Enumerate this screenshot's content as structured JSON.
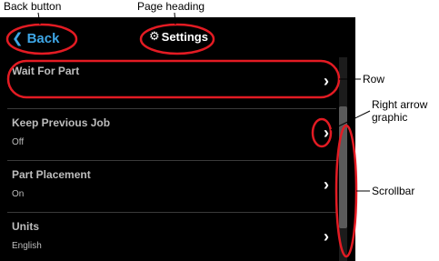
{
  "callouts": {
    "back": "Back button",
    "heading": "Page heading",
    "row": "Row",
    "arrow_line1": "Right arrow",
    "arrow_line2": "graphic",
    "scrollbar": "Scrollbar"
  },
  "header": {
    "back_label": "Back",
    "back_icon": "chevron-left-icon",
    "title": "Settings",
    "title_icon": "gear-icon"
  },
  "rows": [
    {
      "title": "Wait For Part",
      "value": ""
    },
    {
      "title": "Keep Previous Job",
      "value": "Off"
    },
    {
      "title": "Part Placement",
      "value": "On"
    },
    {
      "title": "Units",
      "value": "English"
    }
  ],
  "scrollbar": {
    "position": 0.4
  },
  "colors": {
    "accent": "#3ea6e6",
    "background": "#000000",
    "annotation": "#e31b23",
    "row_text": "#bdbdbd"
  }
}
